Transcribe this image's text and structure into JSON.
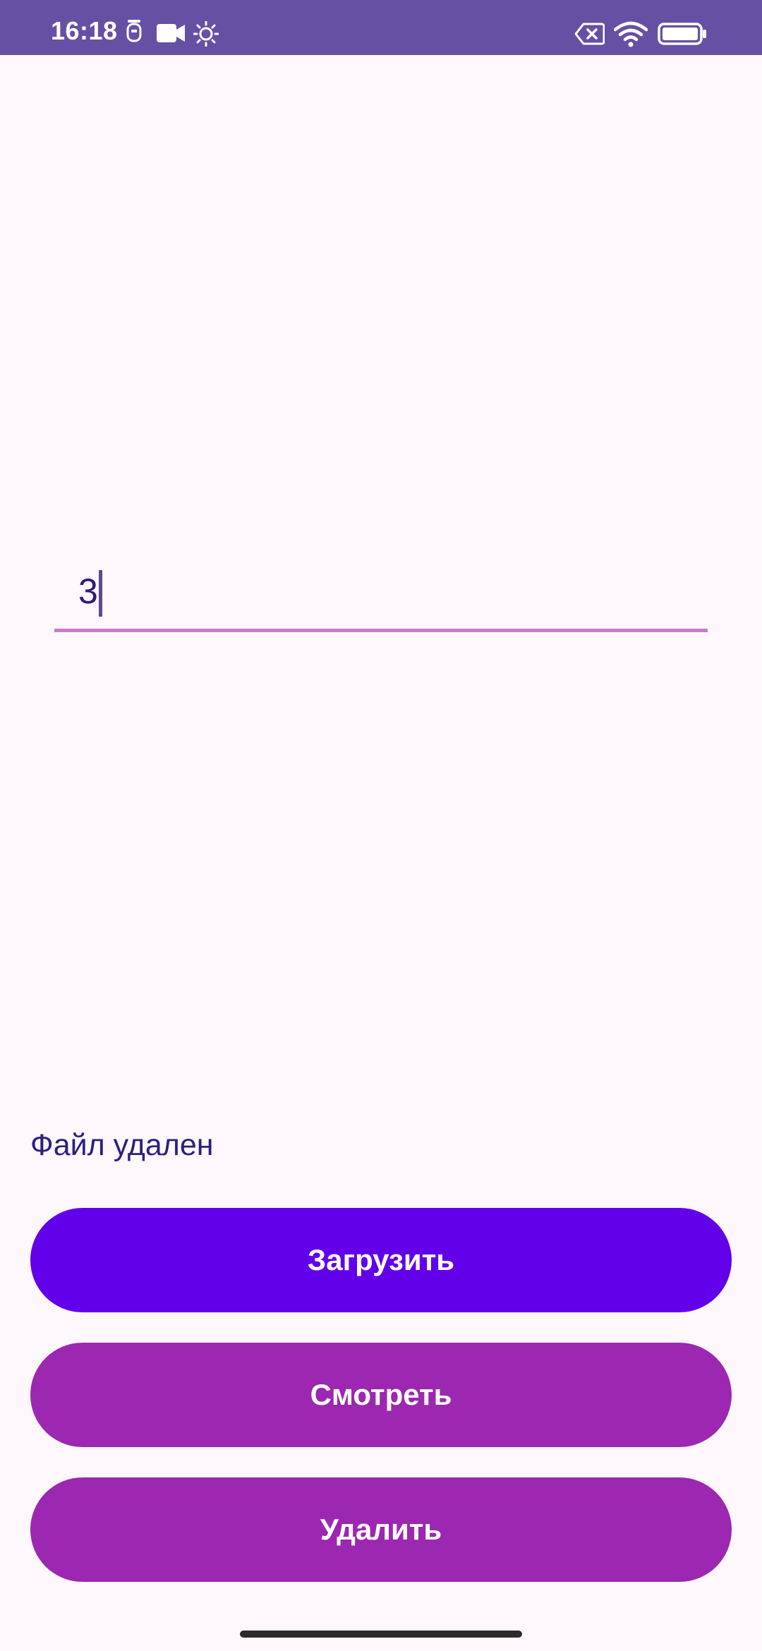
{
  "status_bar": {
    "time": "16:18",
    "background": "#6650a4",
    "icons": [
      "notification-icon",
      "video-camera-icon",
      "brightness-icon",
      "no-sim-icon",
      "wifi-icon",
      "battery-icon"
    ]
  },
  "text_field": {
    "value": "3",
    "underline_color": "#c77dc7"
  },
  "message": {
    "text": "Файл удален"
  },
  "buttons": {
    "upload_label": "Загрузить",
    "view_label": "Смотреть",
    "delete_label": "Удалить",
    "upload_color": "#6200ea",
    "secondary_color": "#9c27b0"
  },
  "background": "#fef7fc"
}
